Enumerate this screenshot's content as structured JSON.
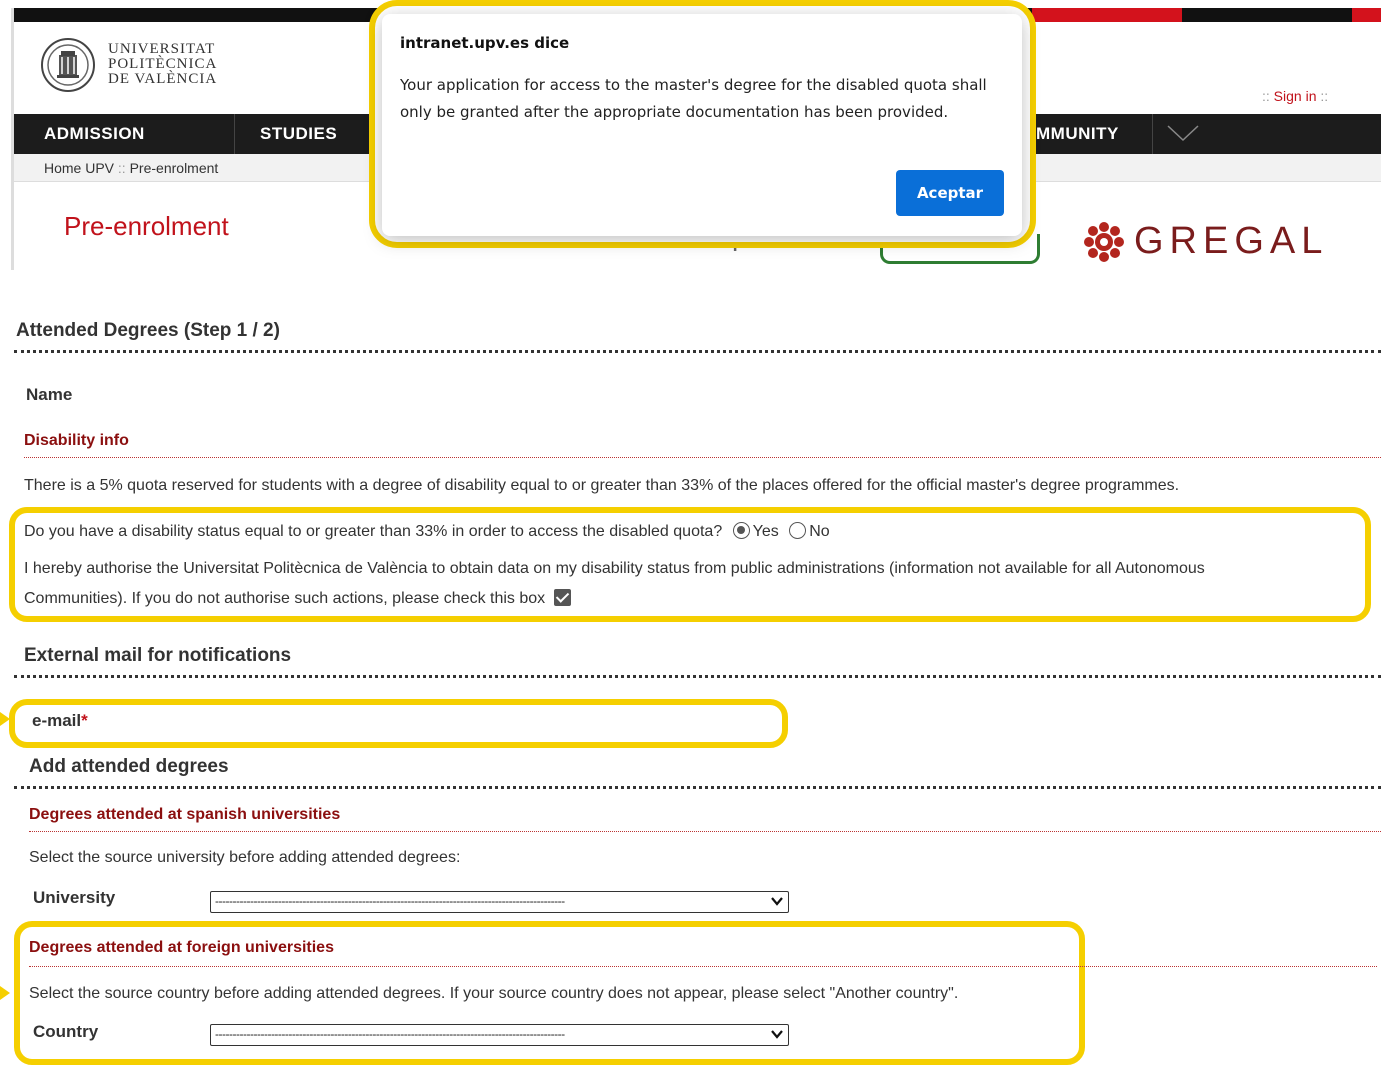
{
  "header": {
    "university_name": [
      "UNIVERSITAT",
      "POLITÈCNICA",
      "DE VALÈNCIA"
    ],
    "sign_in": {
      "prefix": "::",
      "label": "Sign in",
      "suffix": "::"
    },
    "nav": [
      "ADMISSION",
      "STUDIES",
      "MMUNITY"
    ],
    "breadcrumb": {
      "home": "Home UPV",
      "sep": "::",
      "current": "Pre-enrolment"
    },
    "page_title": "Pre-enrolment",
    "partial_help_text": "Help",
    "gregal_label": "GREGAL"
  },
  "dialog": {
    "title": "intranet.upv.es dice",
    "message": "Your application for access to the master's degree for the disabled quota shall only be granted after the appropriate documentation has been provided.",
    "ok_label": "Aceptar"
  },
  "form": {
    "step_heading": "Attended Degrees (Step 1 / 2)",
    "name_label": "Name",
    "disability": {
      "heading": "Disability info",
      "quota_text": "There is a 5% quota reserved for students with a degree of disability equal to or greater than 33% of the places offered for the official master's degree programmes.",
      "question": "Do you have a disability status equal to or greater than 33% in order to access the disabled quota?",
      "yes_label": "Yes",
      "no_label": "No",
      "selected": "Yes",
      "authorise_line1": "I hereby authorise the Universitat Politècnica de València to obtain data on my disability status from public administrations (information not available for all Autonomous",
      "authorise_line2": "Communities). If you do not authorise such actions, please check this box",
      "authorise_checked": true
    },
    "external_mail": {
      "heading": "External mail for notifications",
      "email_label": "e-mail",
      "required_mark": "*"
    },
    "attended": {
      "heading": "Add attended degrees",
      "spanish": {
        "heading": "Degrees attended at spanish universities",
        "instruction": "Select the source university before adding attended degrees:",
        "field_label": "University",
        "selected": "----------------------------------------------------------------------------------------------------"
      },
      "foreign": {
        "heading": "Degrees attended at foreign universities",
        "instruction": "Select the source country before adding attended degrees. If your source country does not appear, please select \"Another country\".",
        "field_label": "Country",
        "selected": "----------------------------------------------------------------------------------------------------"
      }
    }
  },
  "colors": {
    "highlight": "#f5cf00",
    "brand_red": "#c1121b",
    "section_red": "#8b0f0f",
    "dialog_button": "#0a6fd8"
  }
}
